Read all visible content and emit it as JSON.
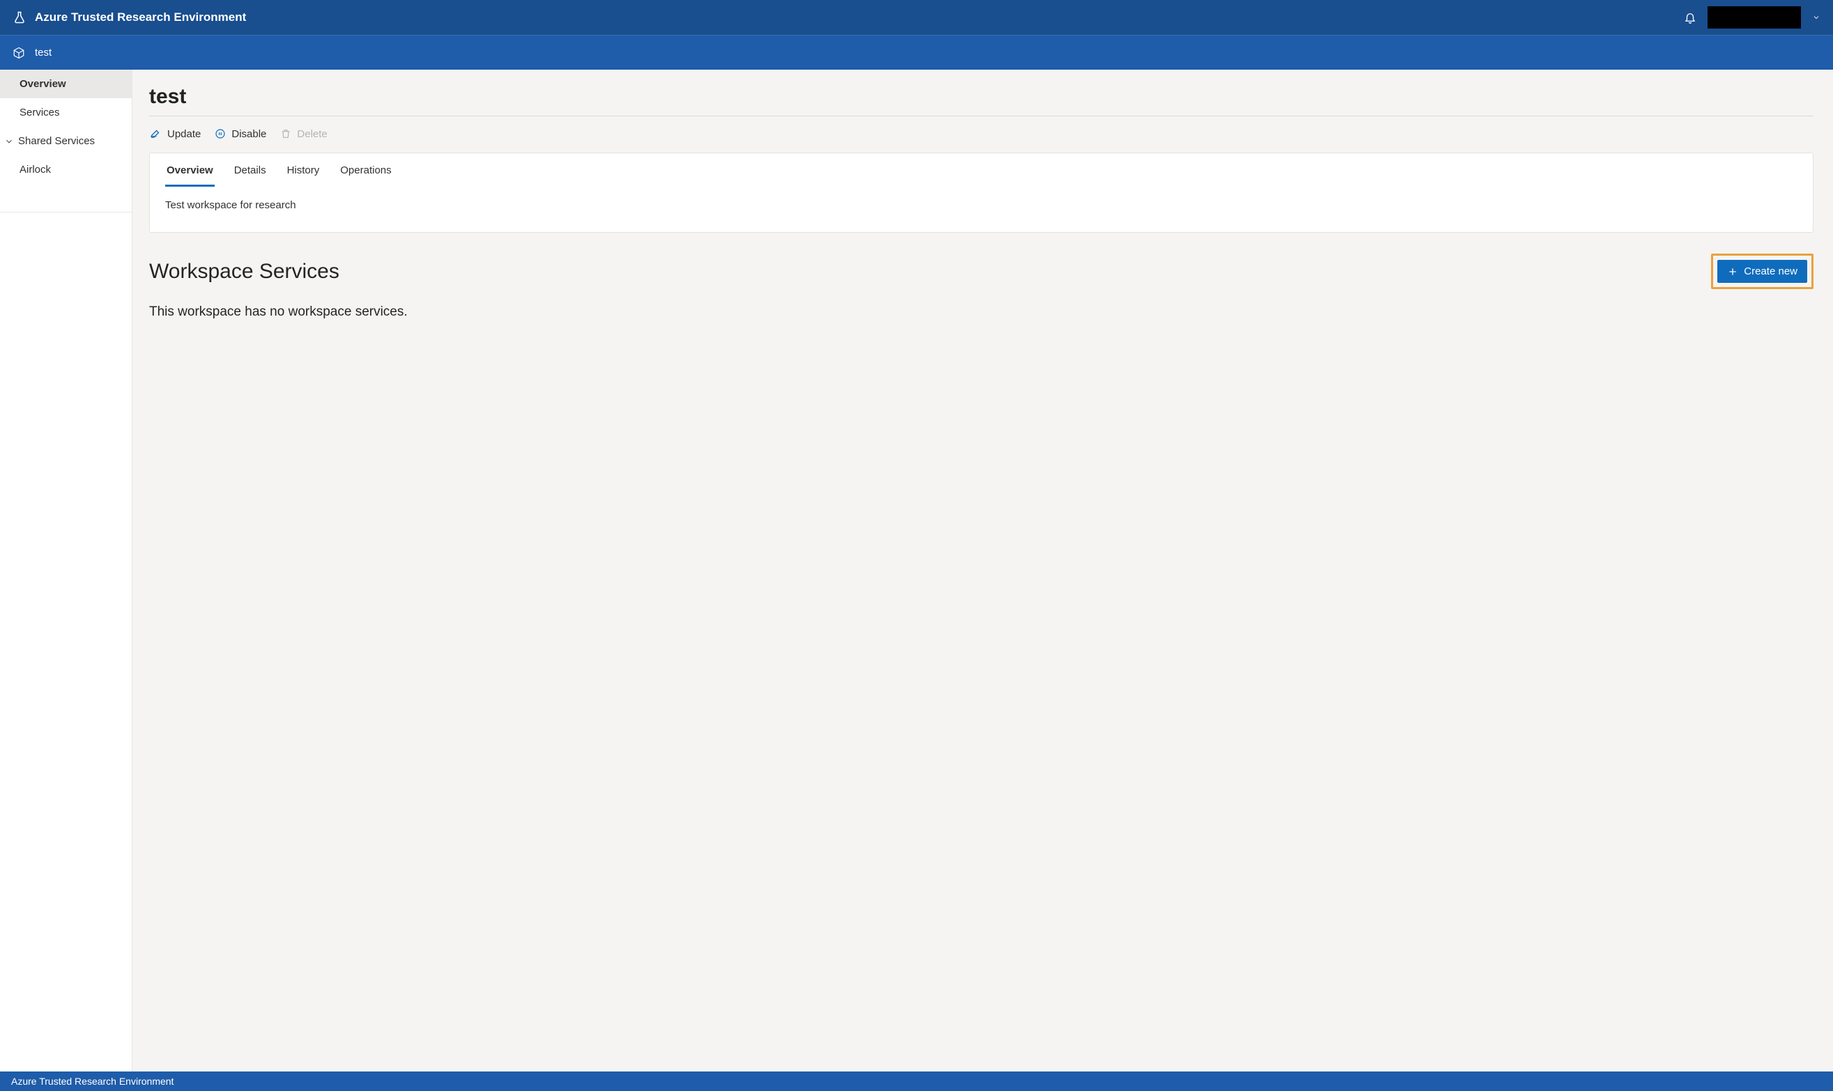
{
  "header": {
    "brand": "Azure Trusted Research Environment"
  },
  "breadcrumb": {
    "current": "test"
  },
  "sidebar": {
    "items": [
      {
        "label": "Overview"
      },
      {
        "label": "Services"
      },
      {
        "label": "Shared Services"
      },
      {
        "label": "Airlock"
      }
    ]
  },
  "page": {
    "title": "test",
    "actions": {
      "update": "Update",
      "disable": "Disable",
      "delete": "Delete"
    },
    "tabs": {
      "overview": "Overview",
      "details": "Details",
      "history": "History",
      "operations": "Operations"
    },
    "description": "Test workspace for research"
  },
  "services_section": {
    "title": "Workspace Services",
    "empty_text": "This workspace has no workspace services.",
    "create_label": "Create new"
  },
  "footer": {
    "text": "Azure Trusted Research Environment"
  }
}
